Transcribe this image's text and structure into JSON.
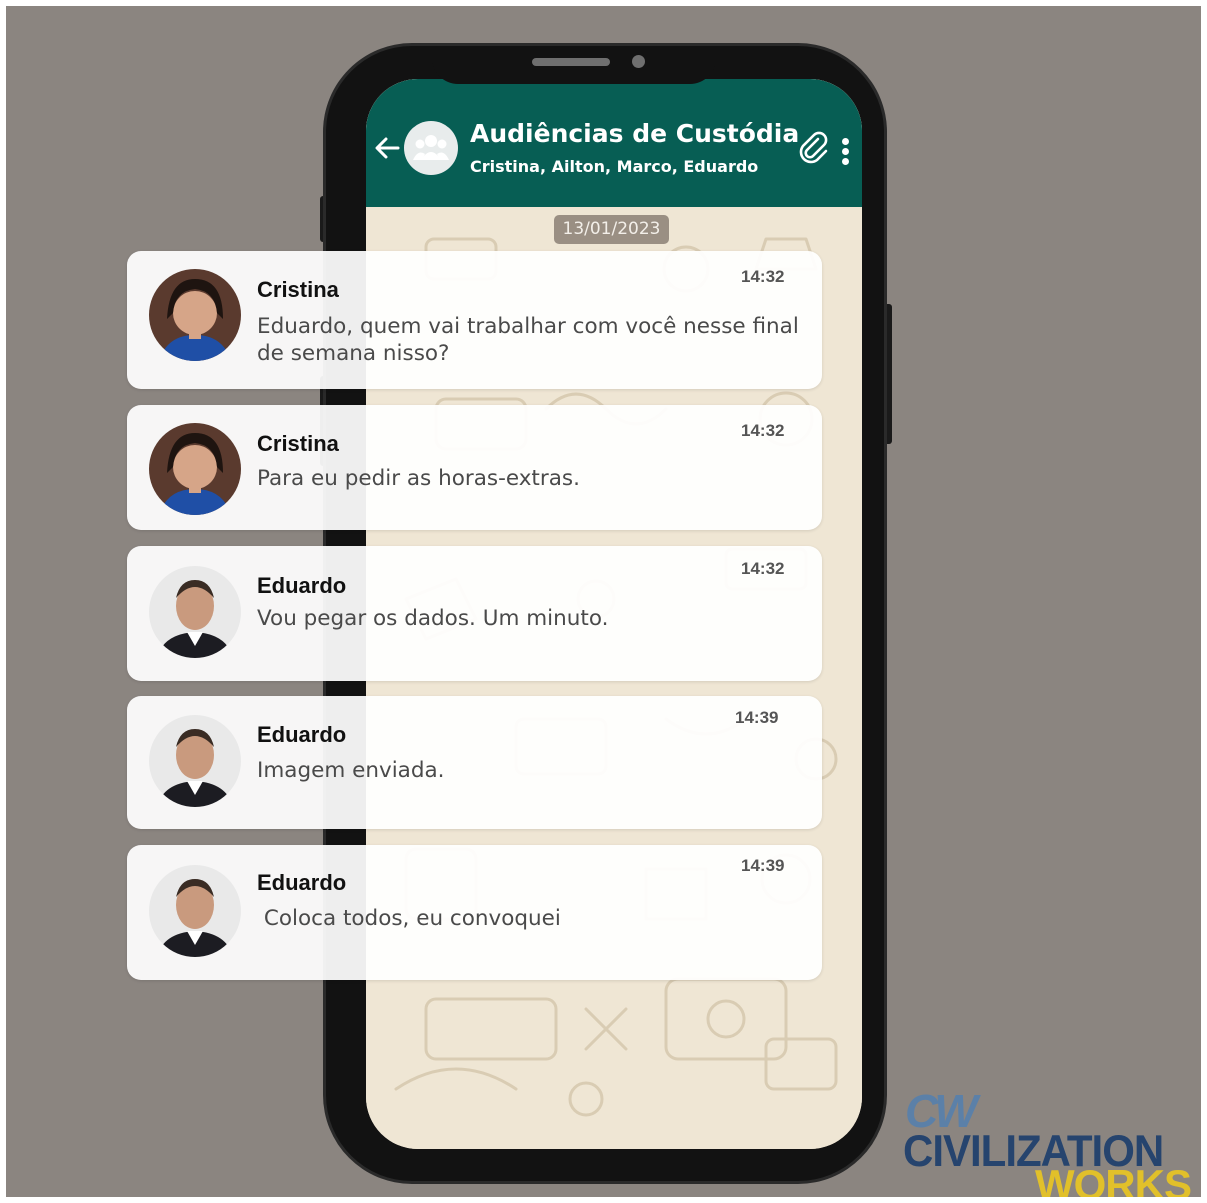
{
  "chat": {
    "title": "Audiências de Custódia",
    "subtitle": "Cristina, Ailton, Marco, Eduardo",
    "date": "13/01/2023",
    "icons": [
      "back-arrow-icon",
      "group-icon",
      "paperclip-icon",
      "more-vertical-icon"
    ]
  },
  "messages": [
    {
      "sender": "Cristina",
      "text": "Eduardo, quem vai trabalhar com você nesse final de semana nisso?",
      "time": "14:32"
    },
    {
      "sender": "Cristina",
      "text": "Para eu pedir as horas-extras.",
      "time": "14:32"
    },
    {
      "sender": "Eduardo",
      "text": "Vou pegar os dados. Um minuto.",
      "time": "14:32"
    },
    {
      "sender": "Eduardo",
      "text": "Imagem enviada.",
      "time": "14:39"
    },
    {
      "sender": "Eduardo",
      "text": " Coloca todos, eu convoquei",
      "time": "14:39"
    }
  ],
  "logo": {
    "mark": "CW",
    "line1": "CIVILIZATION",
    "line2": "WORKS"
  },
  "colors": {
    "header": "#075e54",
    "background": "#8b8580",
    "chat_wallpaper": "#efe6d4",
    "logo_blue": "#26446e",
    "logo_yellow": "#e1c02a"
  }
}
